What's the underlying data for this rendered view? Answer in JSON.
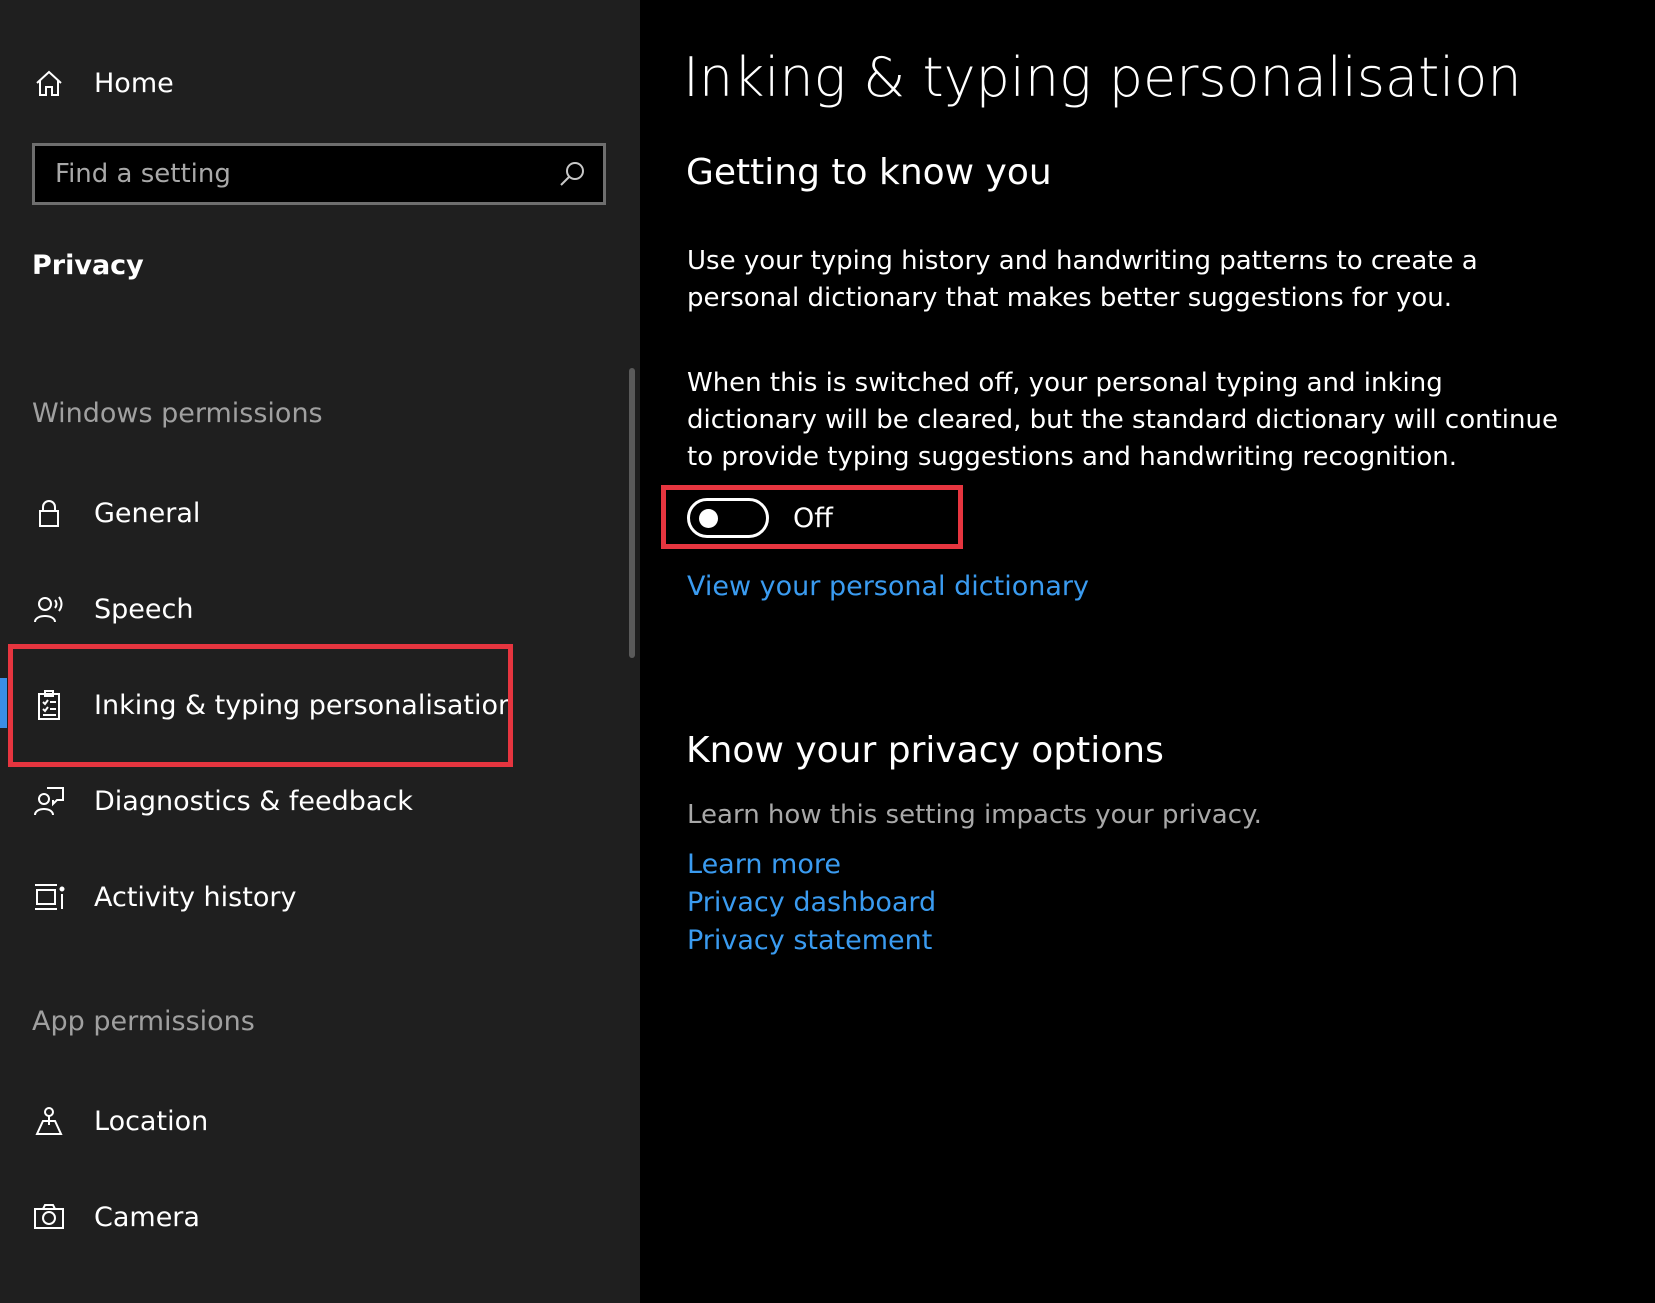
{
  "sidebar": {
    "home_label": "Home",
    "search_placeholder": "Find a setting",
    "section_title": "Privacy",
    "windows_permissions_label": "Windows permissions",
    "windows_items": [
      {
        "label": "General",
        "icon": "lock-icon"
      },
      {
        "label": "Speech",
        "icon": "speech-icon"
      },
      {
        "label": "Inking & typing personalisation",
        "icon": "clipboard-checklist-icon",
        "selected": true
      },
      {
        "label": "Diagnostics & feedback",
        "icon": "diagnostics-feedback-icon"
      },
      {
        "label": "Activity history",
        "icon": "activity-history-icon"
      }
    ],
    "app_permissions_label": "App permissions",
    "app_items": [
      {
        "label": "Location",
        "icon": "location-icon"
      },
      {
        "label": "Camera",
        "icon": "camera-icon"
      }
    ]
  },
  "main": {
    "title": "Inking & typing personalisation",
    "getting_to_know": {
      "heading": "Getting to know you",
      "description": "Use your typing history and handwriting patterns to create a personal dictionary that makes better suggestions for you.",
      "note": "When this is switched off, your personal typing and inking dictionary will be cleared, but the standard dictionary will continue to provide typing suggestions and handwriting recognition.",
      "toggle_state": "Off",
      "dictionary_link": "View your personal dictionary"
    },
    "privacy_options": {
      "heading": "Know your privacy options",
      "description": "Learn how this setting impacts your privacy.",
      "links": [
        "Learn more",
        "Privacy dashboard",
        "Privacy statement"
      ]
    }
  },
  "colors": {
    "sidebar_bg": "#1f1f1f",
    "main_bg": "#000000",
    "accent": "#3a8ee6",
    "link": "#3a9bf0",
    "highlight": "#e6353f"
  }
}
